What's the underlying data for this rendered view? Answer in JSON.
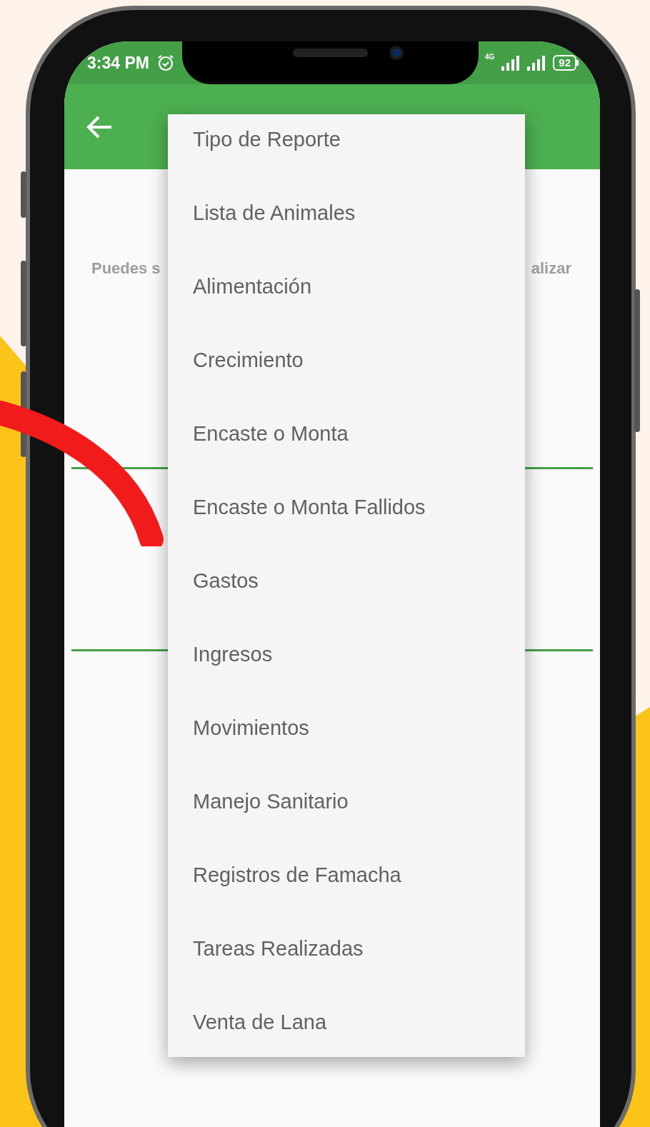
{
  "status_bar": {
    "time": "3:34 PM",
    "network": "4G",
    "battery": "92"
  },
  "description_fragments": {
    "left": "Puedes s",
    "right": "alizar"
  },
  "dropdown_menu": {
    "items": [
      "Tipo de Reporte",
      "Lista de Animales",
      "Alimentación",
      "Crecimiento",
      "Encaste o Monta",
      "Encaste o Monta Fallidos",
      "Gastos",
      "Ingresos",
      "Movimientos",
      "Manejo Sanitario",
      "Registros de Famacha",
      "Tareas Realizadas",
      "Venta de Lana"
    ]
  }
}
